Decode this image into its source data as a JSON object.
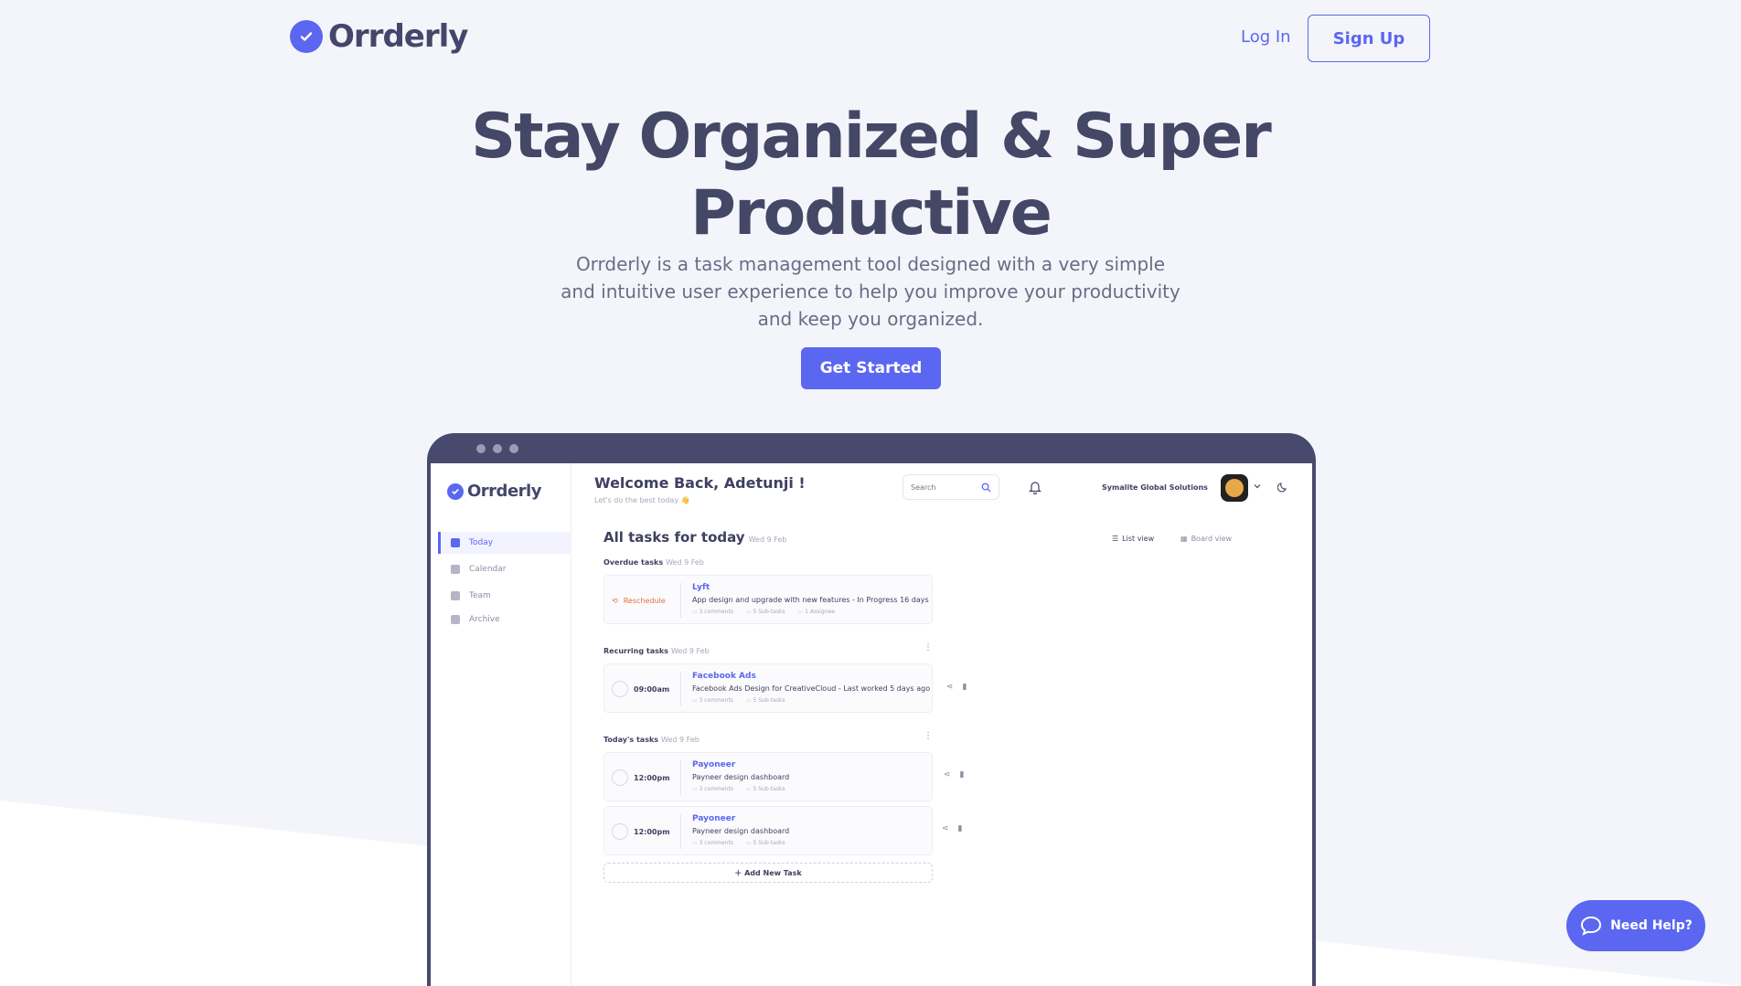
{
  "brand": {
    "name": "Orrderly",
    "accent": "#5b67f1"
  },
  "nav": {
    "login": "Log In",
    "signup": "Sign Up"
  },
  "hero": {
    "title": "Stay Organized & Super Productive",
    "description": "Orrderly is a task management tool designed with a very simple and intuitive user experience to help you improve your productivity and keep you organized.",
    "cta": "Get Started"
  },
  "app": {
    "logo": "Orrderly",
    "sidebar": [
      {
        "label": "Today",
        "active": true
      },
      {
        "label": "Calendar"
      },
      {
        "label": "Team"
      },
      {
        "label": "Archive"
      }
    ],
    "header": {
      "welcome": "Welcome Back, Adetunji !",
      "subtitle": "Let's do the best today 👋",
      "search_placeholder": "Search",
      "company": "Symalite Global Solutions"
    },
    "page_title": "All tasks for today",
    "page_date": "Wed 9 Feb",
    "views": {
      "list": "List view",
      "board": "Board view"
    },
    "sections": {
      "overdue": {
        "label": "Overdue tasks",
        "date": "Wed 9 Feb"
      },
      "recurring": {
        "label": "Recurring tasks",
        "date": "Wed 9 Feb"
      },
      "today": {
        "label": "Today's tasks",
        "date": "Wed 9 Feb"
      }
    },
    "tasks": [
      {
        "left": "Reschedule",
        "name": "Lyft",
        "desc": "App design and upgrade with new features - In Progress 16 days",
        "comments": "3 comments",
        "subtasks": "5 Sub-tasks",
        "assignee": "1 Assignee"
      },
      {
        "left": "09:00am",
        "name": "Facebook Ads",
        "desc": "Facebook Ads Design for CreativeCloud - Last worked 5 days ago",
        "comments": "3 comments",
        "subtasks": "5 Sub-tasks"
      },
      {
        "left": "12:00pm",
        "name": "Payoneer",
        "desc": "Payneer design dashboard",
        "comments": "3 comments",
        "subtasks": "5 Sub-tasks"
      },
      {
        "left": "12:00pm",
        "name": "Payoneer",
        "desc": "Payneer design dashboard",
        "comments": "3 comments",
        "subtasks": "5 Sub-tasks"
      }
    ],
    "add_task": "Add New Task"
  },
  "help": {
    "label": "Need Help?"
  }
}
